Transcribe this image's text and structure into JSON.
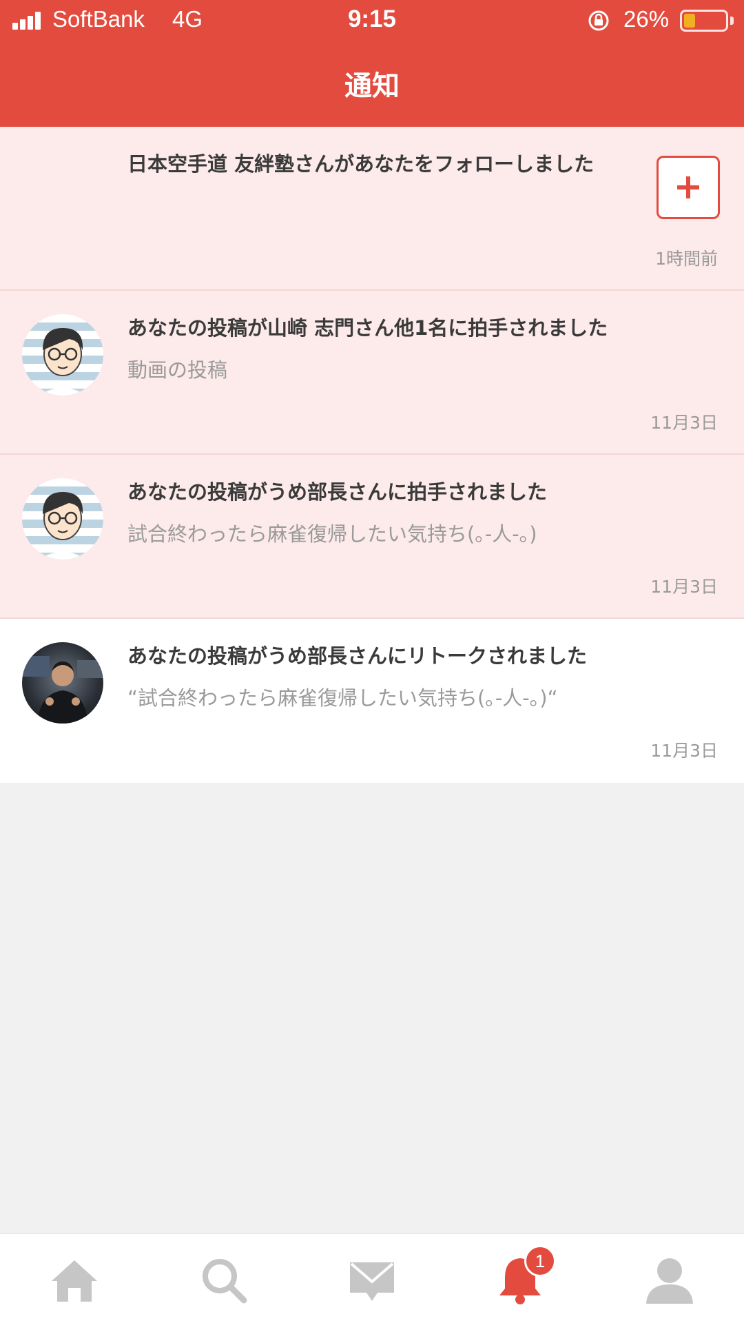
{
  "status_bar": {
    "carrier": "SoftBank",
    "network": "4G",
    "time": "9:15",
    "battery_percent": "26%"
  },
  "header": {
    "title": "通知"
  },
  "notifications": [
    {
      "title": "日本空手道 友絆塾さんがあなたをフォローしました",
      "subtitle": "",
      "time": "1時間前",
      "avatar": "none",
      "follow_icon": "plus-icon"
    },
    {
      "title": "あなたの投稿が山崎 志門さん他1名に拍手されました",
      "subtitle": "動画の投稿",
      "time": "11月3日",
      "avatar": "cartoon-avatar"
    },
    {
      "title": "あなたの投稿がうめ部長さんに拍手されました",
      "subtitle": "試合終わったら麻雀復帰したい気持ち(｡-人-｡)",
      "time": "11月3日",
      "avatar": "cartoon-avatar"
    },
    {
      "title": "あなたの投稿がうめ部長さんにリトークされました",
      "subtitle": "“試合終わったら麻雀復帰したい気持ち(｡-人-｡)“",
      "time": "11月3日",
      "avatar": "photo-avatar"
    }
  ],
  "tabbar": {
    "tabs": [
      {
        "icon": "home-icon",
        "active": false
      },
      {
        "icon": "search-icon",
        "active": false
      },
      {
        "icon": "mail-icon",
        "active": false
      },
      {
        "icon": "bell-icon",
        "active": true
      },
      {
        "icon": "profile-icon",
        "active": false
      }
    ],
    "notification_badge": "1"
  },
  "colors": {
    "accent": "#e44b3f",
    "unread_bg": "#fdeaea",
    "inactive_icon": "#c6c6c6",
    "empty_bg": "#f1f1f1"
  }
}
